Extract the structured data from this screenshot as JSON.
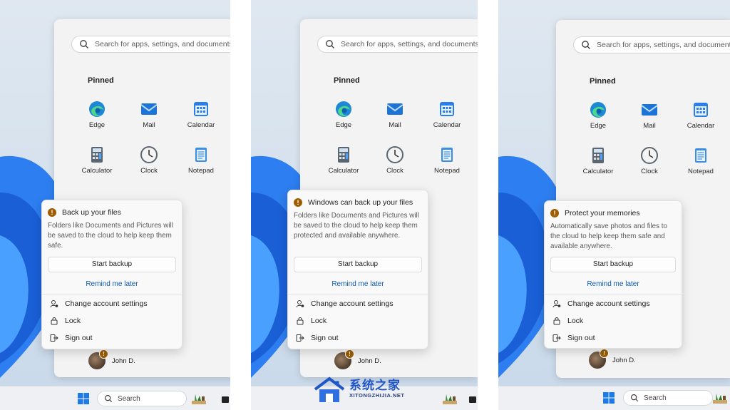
{
  "panels": [
    {
      "search_placeholder": "Search for apps, settings, and documents",
      "pinned_label": "Pinned",
      "apps": [
        "Edge",
        "Mail",
        "Calendar",
        "Calculator",
        "Clock",
        "Notepad"
      ],
      "flyout": {
        "title": "Back up your files",
        "body": "Folders like Documents and Pictures will be saved to the cloud to help keep them safe.",
        "primary_button": "Start backup",
        "link": "Remind me later",
        "menu": [
          "Change account settings",
          "Lock",
          "Sign out"
        ]
      },
      "user_name": "John D.",
      "taskbar_search": "Search"
    },
    {
      "search_placeholder": "Search for apps, settings, and documents",
      "pinned_label": "Pinned",
      "apps": [
        "Edge",
        "Mail",
        "Calendar",
        "Calculator",
        "Clock",
        "Notepad"
      ],
      "flyout": {
        "title": "Windows can back up your files",
        "body": "Folders like Documents and Pictures will be saved to the cloud to help keep them protected and available anywhere.",
        "primary_button": "Start backup",
        "link": "Remind me later",
        "menu": [
          "Change account settings",
          "Lock",
          "Sign out"
        ]
      },
      "user_name": "John D."
    },
    {
      "search_placeholder": "Search for apps, settings, and documents",
      "pinned_label": "Pinned",
      "apps": [
        "Edge",
        "Mail",
        "Calendar",
        "Calculator",
        "Clock",
        "Notepad"
      ],
      "flyout": {
        "title": "Protect your memories",
        "body": "Automatically save photos and files to the cloud to help keep them safe and available anywhere.",
        "primary_button": "Start backup",
        "link": "Remind me later",
        "menu": [
          "Change account settings",
          "Lock",
          "Sign out"
        ]
      },
      "user_name": "John D.",
      "taskbar_search": "Search"
    }
  ],
  "watermark": {
    "title": "系统之家",
    "subtitle": "XITONGZHIJIA.NET"
  },
  "colors": {
    "accent": "#0a5bb5",
    "warning": "#9d5d00",
    "bloom": "#1f6fe0"
  }
}
